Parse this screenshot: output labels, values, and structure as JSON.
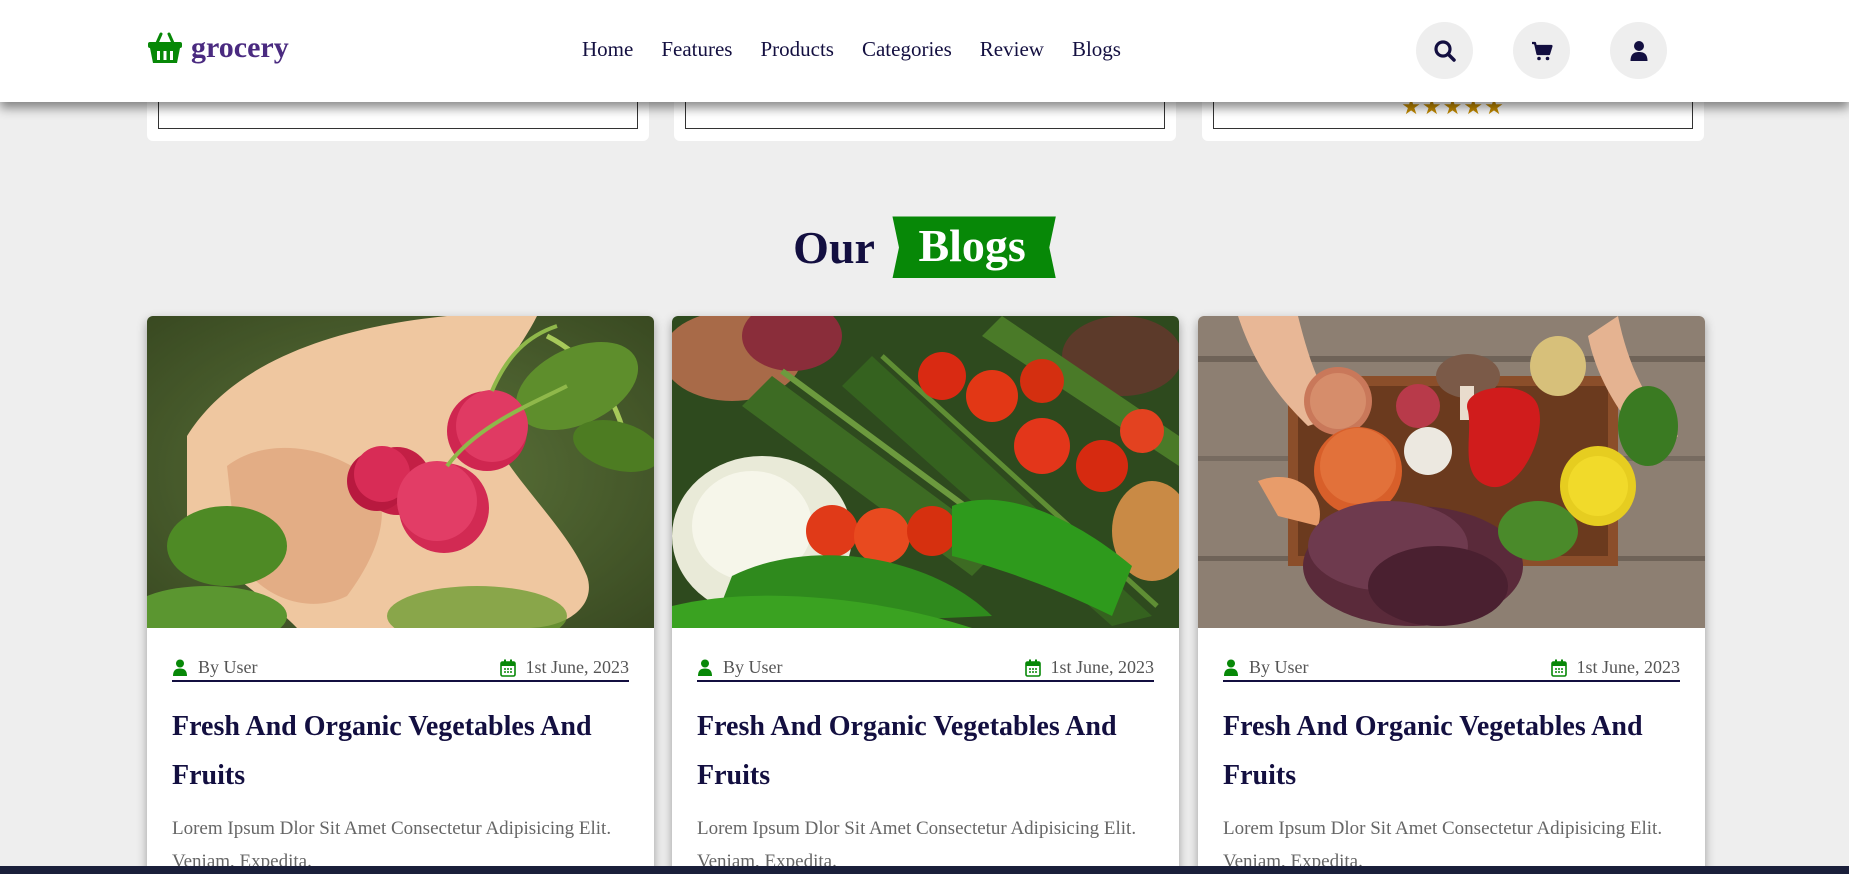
{
  "header": {
    "logo_text": "grocery",
    "nav": [
      "Home",
      "Features",
      "Products",
      "Categories",
      "Review",
      "Blogs"
    ]
  },
  "review_strip": {
    "stars": "★★★★★",
    "rating": 4.5
  },
  "section": {
    "heading_prefix": "Our",
    "heading_tag": "Blogs"
  },
  "blogs": [
    {
      "author": "By User",
      "date": "1st June, 2023",
      "title": "Fresh And Organic Vegetables And Fruits",
      "excerpt": "Lorem Ipsum Dlor Sit Amet Consectetur Adipisicing Elit. Veniam, Expedita."
    },
    {
      "author": "By User",
      "date": "1st June, 2023",
      "title": "Fresh And Organic Vegetables And Fruits",
      "excerpt": "Lorem Ipsum Dlor Sit Amet Consectetur Adipisicing Elit. Veniam, Expedita."
    },
    {
      "author": "By User",
      "date": "1st June, 2023",
      "title": "Fresh And Organic Vegetables And Fruits",
      "excerpt": "Lorem Ipsum Dlor Sit Amet Consectetur Adipisicing Elit. Veniam, Expedita."
    }
  ],
  "colors": {
    "accent": "#078807",
    "dark": "#130f40",
    "background": "#eeeeee",
    "star": "#c28a00"
  },
  "icons": [
    "basket-icon",
    "search-icon",
    "cart-icon",
    "user-icon",
    "calendar-icon"
  ]
}
